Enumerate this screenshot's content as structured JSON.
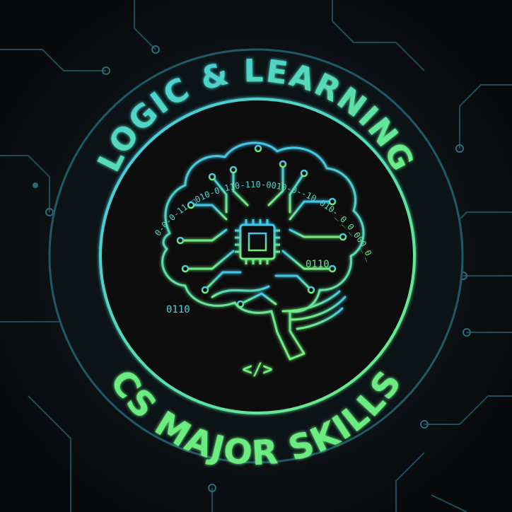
{
  "badge": {
    "top_text": "LOGIC & LEARNING",
    "bottom_text": "CS MAJOR SKILLS",
    "binary_arc": "0-0-0-11-□010-0-110-110-0010-0--10-010-_0_0_000_0_",
    "binary_left": "0110",
    "binary_right": "0110",
    "code_symbol": "</>"
  },
  "colors": {
    "background": "#0b0f12",
    "circuit_trace": "#1f5560",
    "gradient_start": "#3fc8ea",
    "gradient_end": "#6ff07c"
  },
  "icons": [
    "brain-circuit-icon",
    "microchip-icon",
    "code-brackets-icon"
  ]
}
